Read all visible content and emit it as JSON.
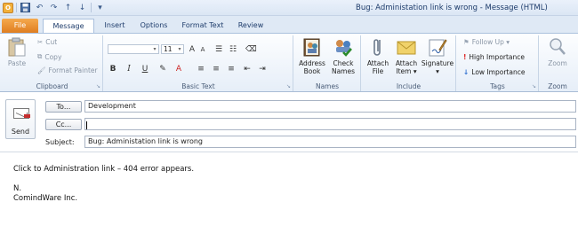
{
  "window": {
    "title": "Bug: Administation link is wrong  -  Message (HTML)"
  },
  "quick_access": {
    "icons": [
      "outlook-icon",
      "save-icon",
      "undo-icon",
      "redo-icon",
      "up-arrow-icon",
      "down-arrow-icon",
      "customize-icon"
    ]
  },
  "tabs": [
    {
      "label": "File"
    },
    {
      "label": "Message"
    },
    {
      "label": "Insert"
    },
    {
      "label": "Options"
    },
    {
      "label": "Format Text"
    },
    {
      "label": "Review"
    }
  ],
  "ribbon": {
    "clipboard": {
      "label": "Clipboard",
      "paste": "Paste",
      "cut": "Cut",
      "copy": "Copy",
      "format_painter": "Format Painter"
    },
    "basic_text": {
      "label": "Basic Text",
      "font_size": "11",
      "bold": "B",
      "italic": "I",
      "underline": "U"
    },
    "names": {
      "label": "Names",
      "address_book": [
        "Address",
        "Book"
      ],
      "check_names": [
        "Check",
        "Names"
      ]
    },
    "include": {
      "label": "Include",
      "attach_file": [
        "Attach",
        "File"
      ],
      "attach_item": [
        "Attach",
        "Item ▾"
      ],
      "signature": "Signature ▾"
    },
    "tags": {
      "label": "Tags",
      "follow_up": "Follow Up ▾",
      "high_importance": "High Importance",
      "low_importance": "Low Importance"
    },
    "zoom": {
      "label": "Zoom",
      "zoom": "Zoom"
    }
  },
  "compose": {
    "send_label": "Send",
    "to_button": "To...",
    "to_value": "Development",
    "cc_button": "Cc...",
    "cc_value": "",
    "subject_label": "Subject:",
    "subject_value": "Bug: Administation link is wrong"
  },
  "message_body": {
    "lines": [
      "Click to Administration link – 404 error appears.",
      "",
      "N.",
      "ComindWare Inc."
    ]
  }
}
